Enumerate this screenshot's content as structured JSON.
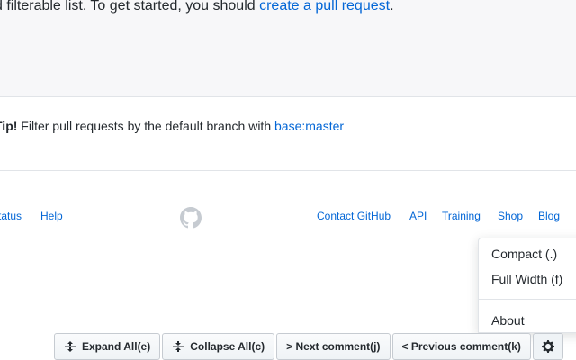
{
  "blank_state": {
    "text_before": "d filterable list. To get started, you should ",
    "link": "create a pull request",
    "text_after": "."
  },
  "tip": {
    "prefix": "Tip!",
    "text": " Filter pull requests by the default branch with ",
    "query": "base:master"
  },
  "footer": {
    "left_links": [
      "tatus",
      "Help"
    ],
    "right_links": [
      "Contact GitHub",
      "API",
      "Training",
      "Shop",
      "Blog"
    ],
    "logo_icon": "github-mark-icon"
  },
  "menu": {
    "items": [
      "Compact (.)",
      "Full Width (f)",
      "About"
    ]
  },
  "toolbar": {
    "expand_all": "Expand All(e)",
    "collapse_all": "Collapse All(c)",
    "next_comment": "> Next comment(j)",
    "previous_comment": "< Previous comment(k)",
    "settings_icon": "gear-icon"
  },
  "colors": {
    "link": "#0366d6",
    "text": "#24292e",
    "border": "#e1e4e8",
    "blankslate_bg": "#f7f7f9"
  }
}
